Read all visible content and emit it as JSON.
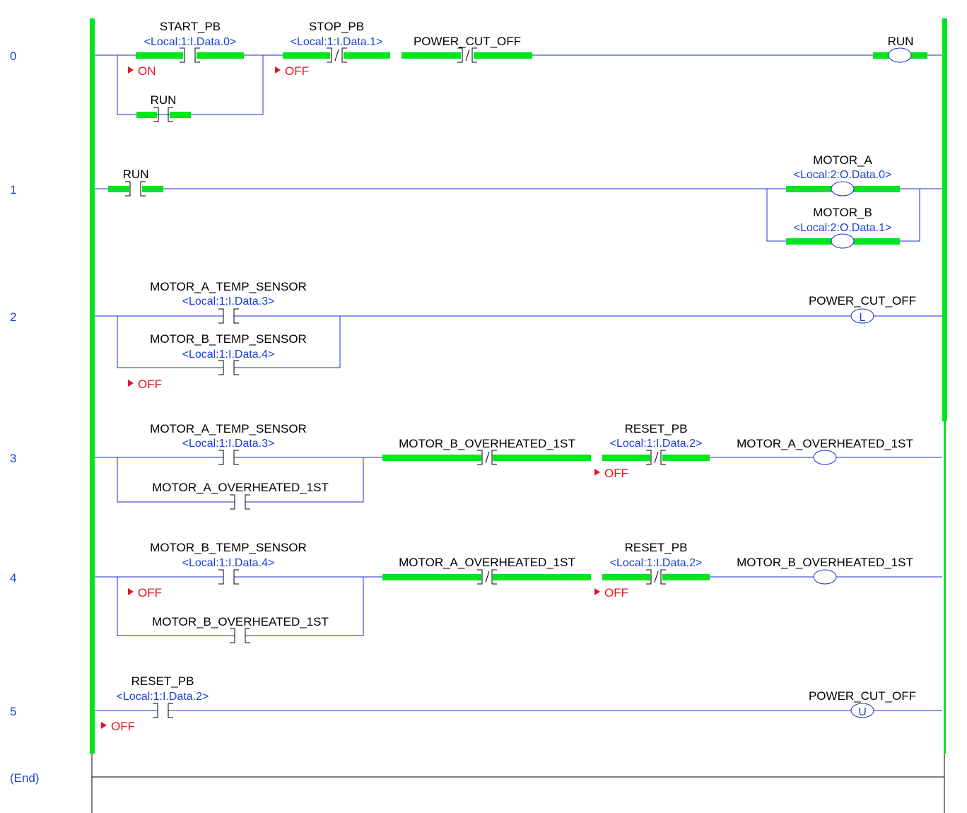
{
  "rails": {
    "energized_color": "#00e61e",
    "wire_color": "#1a2ccf",
    "address_color": "#1a3fd8",
    "status_color": "#e8141b"
  },
  "rungs": [
    {
      "number": "0",
      "inputs": [
        {
          "tag": "START_PB",
          "address": "<Local:1:I.Data.0>",
          "type": "xic",
          "energized": true,
          "status": "ON"
        },
        {
          "tag": "RUN",
          "address": "",
          "type": "xic",
          "energized": true,
          "status": "",
          "branch": true
        },
        {
          "tag": "STOP_PB",
          "address": "<Local:1:I.Data.1>",
          "type": "xio",
          "energized": true,
          "status": "OFF"
        },
        {
          "tag": "POWER_CUT_OFF",
          "address": "",
          "type": "xio",
          "energized": true,
          "status": ""
        }
      ],
      "outputs": [
        {
          "tag": "RUN",
          "address": "",
          "type": "ote",
          "energized": true
        }
      ]
    },
    {
      "number": "1",
      "inputs": [
        {
          "tag": "RUN",
          "address": "",
          "type": "xic",
          "energized": true,
          "status": ""
        }
      ],
      "outputs": [
        {
          "tag": "MOTOR_A",
          "address": "<Local:2:O.Data.0>",
          "type": "ote",
          "energized": true
        },
        {
          "tag": "MOTOR_B",
          "address": "<Local:2:O.Data.1>",
          "type": "ote",
          "energized": true
        }
      ]
    },
    {
      "number": "2",
      "inputs": [
        {
          "tag": "MOTOR_A_TEMP_SENSOR",
          "address": "<Local:1:I.Data.3>",
          "type": "xic",
          "energized": false,
          "status": ""
        },
        {
          "tag": "MOTOR_B_TEMP_SENSOR",
          "address": "<Local:1:I.Data.4>",
          "type": "xic",
          "energized": false,
          "status": "OFF",
          "branch": true
        }
      ],
      "outputs": [
        {
          "tag": "POWER_CUT_OFF",
          "address": "",
          "type": "otl",
          "symbol": "L",
          "energized": false
        }
      ]
    },
    {
      "number": "3",
      "inputs": [
        {
          "tag": "MOTOR_A_TEMP_SENSOR",
          "address": "<Local:1:I.Data.3>",
          "type": "xic",
          "energized": false,
          "status": ""
        },
        {
          "tag": "MOTOR_A_OVERHEATED_1ST",
          "address": "",
          "type": "xic",
          "energized": false,
          "status": "",
          "branch": true
        },
        {
          "tag": "MOTOR_B_OVERHEATED_1ST",
          "address": "",
          "type": "xio",
          "energized": true,
          "status": ""
        },
        {
          "tag": "RESET_PB",
          "address": "<Local:1:I.Data.2>",
          "type": "xio",
          "energized": true,
          "status": "OFF"
        }
      ],
      "outputs": [
        {
          "tag": "MOTOR_A_OVERHEATED_1ST",
          "address": "",
          "type": "ote",
          "energized": false
        }
      ]
    },
    {
      "number": "4",
      "inputs": [
        {
          "tag": "MOTOR_B_TEMP_SENSOR",
          "address": "<Local:1:I.Data.4>",
          "type": "xic",
          "energized": false,
          "status": "OFF"
        },
        {
          "tag": "MOTOR_B_OVERHEATED_1ST",
          "address": "",
          "type": "xic",
          "energized": false,
          "status": "",
          "branch": true
        },
        {
          "tag": "MOTOR_A_OVERHEATED_1ST",
          "address": "",
          "type": "xio",
          "energized": true,
          "status": ""
        },
        {
          "tag": "RESET_PB",
          "address": "<Local:1:I.Data.2>",
          "type": "xio",
          "energized": true,
          "status": "OFF"
        }
      ],
      "outputs": [
        {
          "tag": "MOTOR_B_OVERHEATED_1ST",
          "address": "",
          "type": "ote",
          "energized": false
        }
      ]
    },
    {
      "number": "5",
      "inputs": [
        {
          "tag": "RESET_PB",
          "address": "<Local:1:I.Data.2>",
          "type": "xic",
          "energized": false,
          "status": "OFF"
        }
      ],
      "outputs": [
        {
          "tag": "POWER_CUT_OFF",
          "address": "",
          "type": "otu",
          "symbol": "U",
          "energized": false
        }
      ]
    }
  ],
  "end_label": "(End)"
}
